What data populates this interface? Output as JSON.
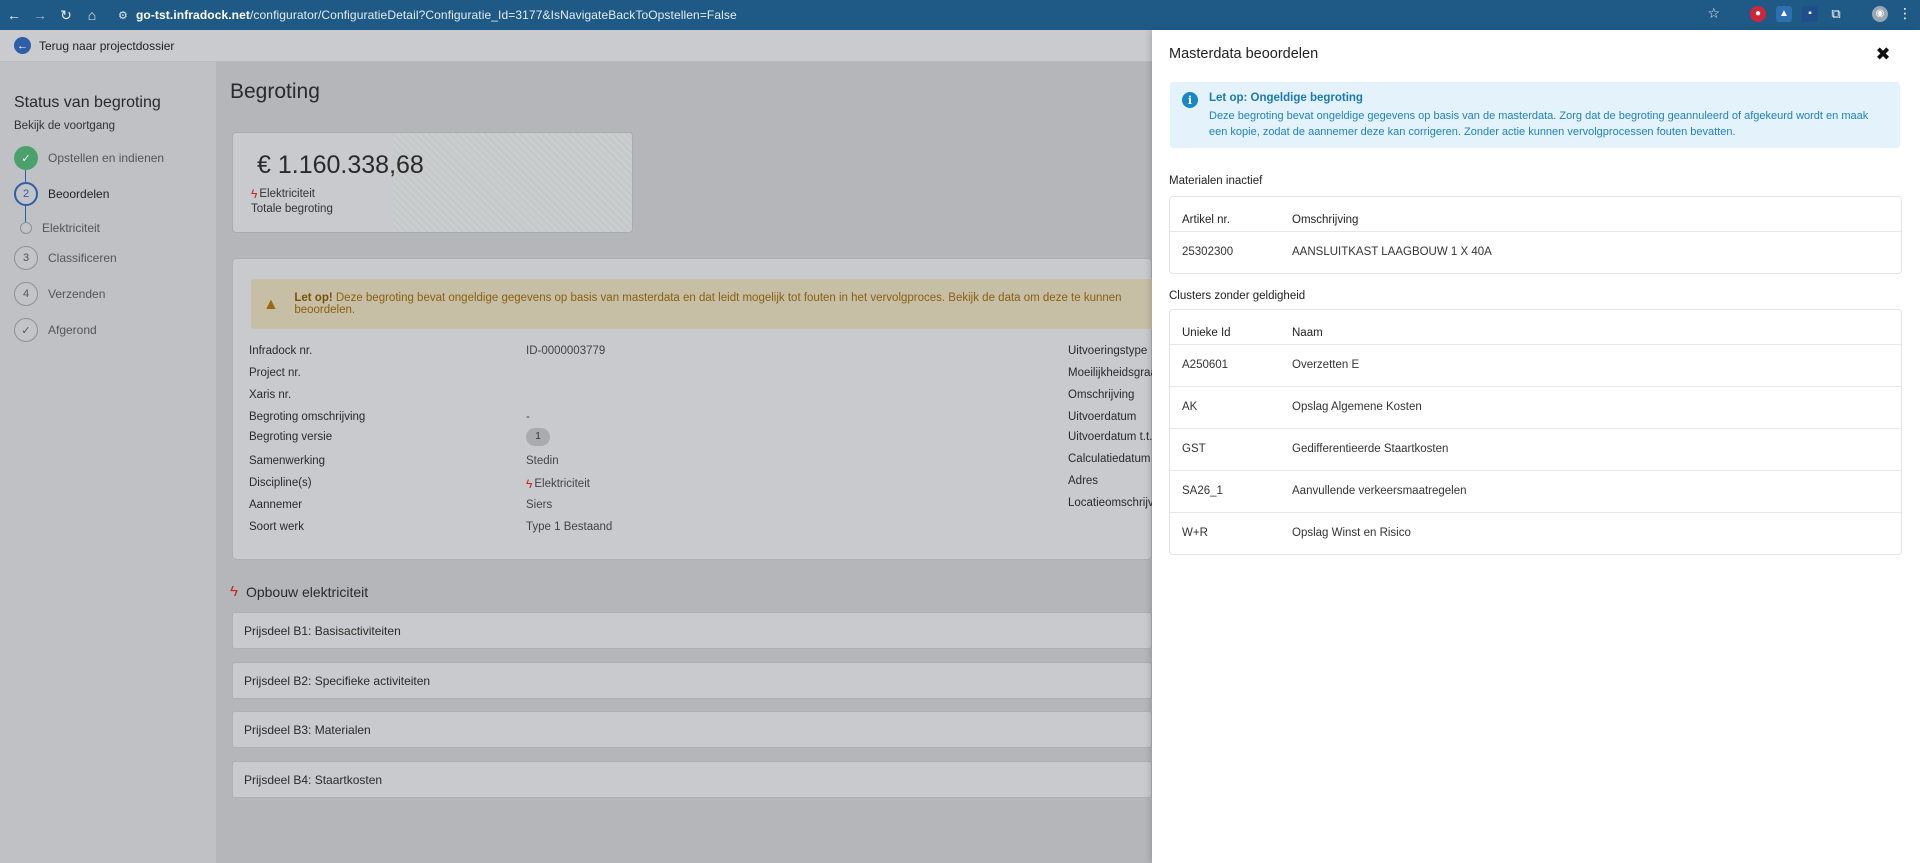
{
  "browser": {
    "url_host": "go-tst.infradock.net",
    "url_path": "/configurator/ConfiguratieDetail?Configuratie_Id=3177&IsNavigateBackToOpstellen=False"
  },
  "app_bar": {
    "back_label": "Terug naar projectdossier"
  },
  "sidebar": {
    "title": "Status van begroting",
    "subtitle": "Bekijk de voortgang",
    "steps": [
      {
        "label": "Opstellen en indienen",
        "marker": "✓",
        "state": "done"
      },
      {
        "label": "Beoordelen",
        "marker": "2",
        "state": "active"
      },
      {
        "label": "Elektriciteit",
        "marker": "",
        "state": "sub"
      },
      {
        "label": "Classificeren",
        "marker": "3",
        "state": "todo"
      },
      {
        "label": "Verzenden",
        "marker": "4",
        "state": "todo"
      },
      {
        "label": "Afgerond",
        "marker": "✓",
        "state": "todo"
      }
    ]
  },
  "main": {
    "title": "Begroting",
    "total": {
      "amount": "€ 1.160.338,68",
      "discipline": "Elektriciteit",
      "label": "Totale begroting"
    },
    "warning": {
      "bold": "Let op!",
      "text": " Deze begroting bevat ongeldige gegevens op basis van masterdata en dat leidt mogelijk tot fouten in het vervolgproces. Bekijk de data om deze te kunnen beoordelen."
    },
    "details_left": [
      {
        "label": "Infradock nr.",
        "value": "ID-0000003779"
      },
      {
        "label": "Project nr.",
        "value": ""
      },
      {
        "label": "Xaris nr.",
        "value": ""
      },
      {
        "label": "Begroting omschrijving",
        "value": "-"
      },
      {
        "label": "Begroting versie",
        "value": "1"
      },
      {
        "label": "Samenwerking",
        "value": "Stedin"
      },
      {
        "label": "Discipline(s)",
        "value": "Elektriciteit"
      },
      {
        "label": "Aannemer",
        "value": "Siers"
      },
      {
        "label": "Soort werk",
        "value": "Type 1 Bestaand"
      }
    ],
    "details_right": [
      "Uitvoeringstype",
      "Moeilijkheidsgraad",
      "Omschrijving",
      "Uitvoerdatum",
      "Uitvoerdatum t.t.v.",
      "Calculatiedatum",
      "Adres",
      "Locatieomschrijving"
    ],
    "section_title": "Opbouw elektriciteit",
    "accordions": [
      "Prijsdeel B1: Basisactiviteiten",
      "Prijsdeel B2: Specifieke activiteiten",
      "Prijsdeel B3: Materialen",
      "Prijsdeel B4: Staartkosten"
    ]
  },
  "panel": {
    "title": "Masterdata beoordelen",
    "alert": {
      "title": "Let op: Ongeldige begroting",
      "body": "Deze begroting bevat ongeldige gegevens op basis van de masterdata. Zorg dat de begroting geannuleerd of afgekeurd wordt en maak een kopie, zodat de aannemer deze kan corrigeren. Zonder actie kunnen vervolgprocessen fouten bevatten."
    },
    "materials": {
      "title": "Materialen inactief",
      "columns": [
        "Artikel nr.",
        "Omschrijving"
      ],
      "rows": [
        [
          "25302300",
          "AANSLUITKAST LAAGBOUW 1 X 40A"
        ]
      ]
    },
    "clusters": {
      "title": "Clusters zonder geldigheid",
      "columns": [
        "Unieke Id",
        "Naam"
      ],
      "rows": [
        [
          "A250601",
          "Overzetten E"
        ],
        [
          "AK",
          "Opslag Algemene Kosten"
        ],
        [
          "GST",
          "Gedifferentieerde Staartkosten"
        ],
        [
          "SA26_1",
          "Aanvullende verkeersmaatregelen"
        ],
        [
          "W+R",
          "Opslag Winst en Risico"
        ]
      ]
    }
  }
}
